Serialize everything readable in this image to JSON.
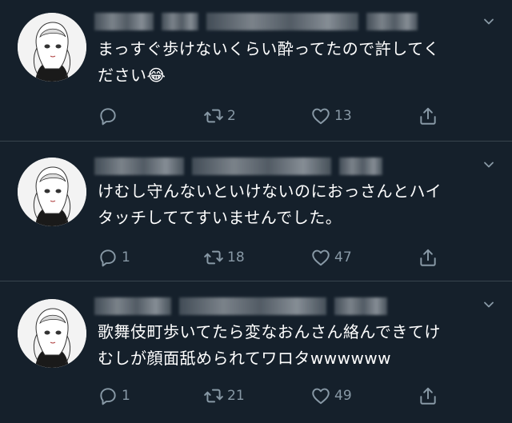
{
  "colors": {
    "background": "#15202b",
    "divider": "#38444d",
    "text": "#ffffff",
    "icon": "#8899a6"
  },
  "tweets": [
    {
      "avatar": "manga-girl-avatar",
      "author_hidden": true,
      "lines": [
        "まっすぐ歩けないくらい酔ってたので許してく",
        "ださい"
      ],
      "emoji": "😂",
      "reply_count": "",
      "retweet_count": "2",
      "like_count": "13"
    },
    {
      "avatar": "manga-girl-avatar",
      "author_hidden": true,
      "lines": [
        "けむし守んないといけないのにおっさんとハイ",
        "タッチしててすいませんでした。"
      ],
      "emoji": "",
      "reply_count": "1",
      "retweet_count": "18",
      "like_count": "47"
    },
    {
      "avatar": "manga-girl-avatar",
      "author_hidden": true,
      "lines": [
        "歌舞伎町歩いてたら変なおんさん絡んできてけ",
        "むしが顔面舐められてワロタwwwwww"
      ],
      "emoji": "",
      "reply_count": "1",
      "retweet_count": "21",
      "like_count": "49"
    }
  ],
  "icons": {
    "reply": "reply-icon",
    "retweet": "retweet-icon",
    "like": "heart-icon",
    "share": "share-icon",
    "more": "chevron-down-icon"
  }
}
